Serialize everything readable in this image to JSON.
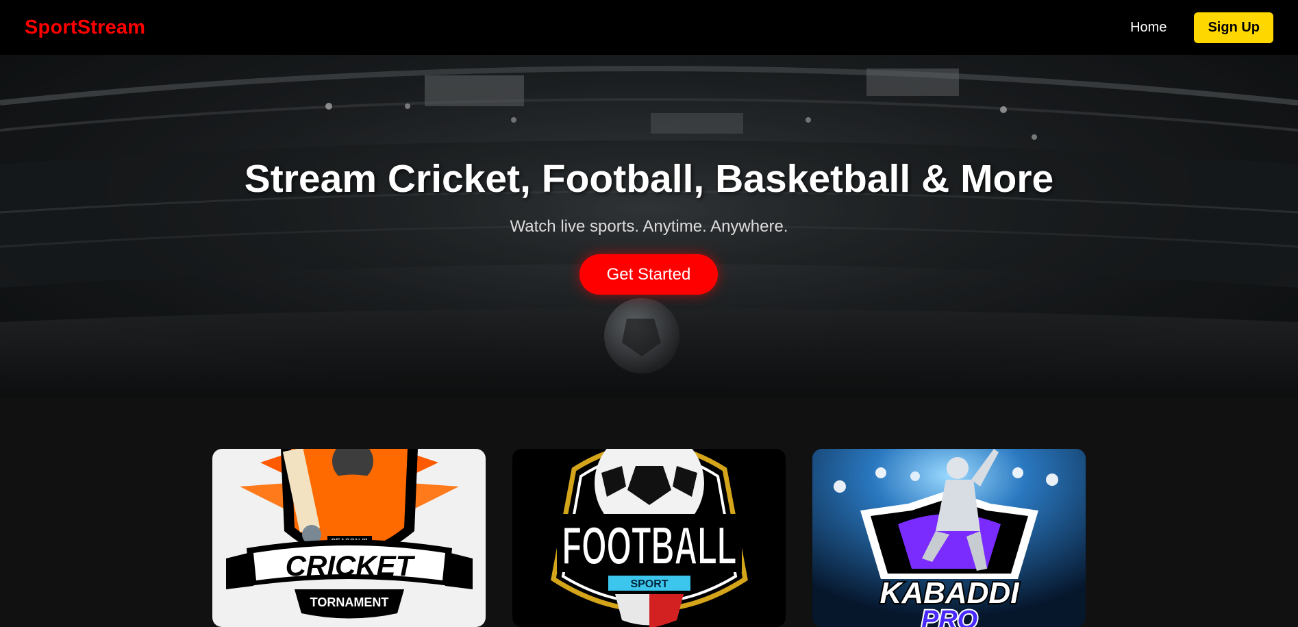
{
  "header": {
    "logo": "SportStream",
    "nav": {
      "home_label": "Home",
      "signup_label": "Sign Up"
    }
  },
  "hero": {
    "title": "Stream Cricket, Football, Basketball & More",
    "subtitle": "Watch live sports. Anytime. Anywhere.",
    "cta_label": "Get Started"
  },
  "cards": [
    {
      "badge_small": "SEASON III",
      "title": "CRICKET",
      "subtitle": "TORNAMENT"
    },
    {
      "title": "FOOTBALL",
      "subtitle": "SPORT"
    },
    {
      "title": "KABADDI",
      "subtitle": "PRO"
    }
  ],
  "colors": {
    "brand": "#ff0000",
    "signup": "#ffd700",
    "header_bg": "#000000",
    "page_bg": "#111111"
  }
}
